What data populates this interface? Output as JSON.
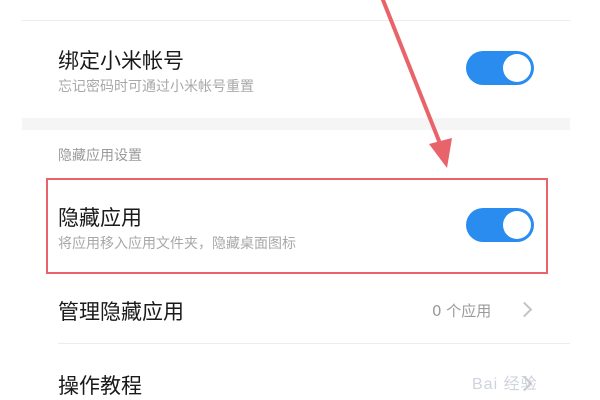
{
  "bind_mi_account": {
    "title": "绑定小米帐号",
    "subtitle": "忘记密码时可通过小米帐号重置",
    "enabled": true
  },
  "section_header": "隐藏应用设置",
  "hide_apps": {
    "title": "隐藏应用",
    "subtitle": "将应用移入应用文件夹，隐藏桌面图标",
    "enabled": true
  },
  "manage_hidden": {
    "title": "管理隐藏应用",
    "value": "0 个应用"
  },
  "tutorial": {
    "title": "操作教程"
  },
  "watermark": "Bai 经验",
  "colors": {
    "toggle_on": "#2b8cf0",
    "highlight": "#e9636a",
    "arrow": "#e9636a"
  }
}
